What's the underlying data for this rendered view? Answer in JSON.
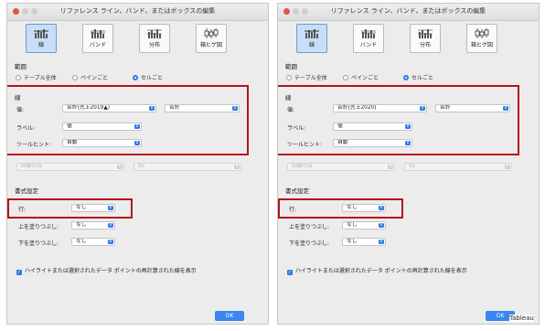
{
  "dialog_title": "リファレンス ライン、バンド、またはボックスの編集",
  "types": [
    {
      "label": "線",
      "icon": "line-type-icon"
    },
    {
      "label": "バンド",
      "icon": "band-type-icon"
    },
    {
      "label": "分布",
      "icon": "distribution-type-icon"
    },
    {
      "label": "箱ヒゲ図",
      "icon": "boxplot-type-icon"
    }
  ],
  "scope": {
    "heading": "範囲",
    "options": [
      "テーブル全体",
      "ペインごと",
      "セルごと"
    ],
    "selected": "セルごと"
  },
  "line": {
    "heading": "線",
    "value_label": "値:",
    "label_label": "ラベル:",
    "label_value": "値",
    "tooltip_label": "ツールヒント:",
    "tooltip_value": "自動",
    "aggregation": "合計"
  },
  "disabled_fields": [
    "回線のみ",
    "95"
  ],
  "format": {
    "heading": "書式設定",
    "row_label": "行:",
    "row_value": "なし",
    "fill_above_label": "上を塗りつぶし:",
    "fill_above_value": "なし",
    "fill_below_label": "下を塗りつぶし:",
    "fill_below_value": "なし"
  },
  "recalc_checkbox": {
    "label": "ハイライトまたは選択されたデータ ポイントの再計算された線を表示",
    "checked": true
  },
  "ok_label": "OK",
  "panels": [
    {
      "value_field": "合計(売上2019▲)"
    },
    {
      "value_field": "合計(売上2020)"
    }
  ],
  "watermark": "Tableau",
  "colors": {
    "accent": "#2f79e8",
    "highlight": "#b4121b",
    "selected_type": "#c9def6"
  }
}
